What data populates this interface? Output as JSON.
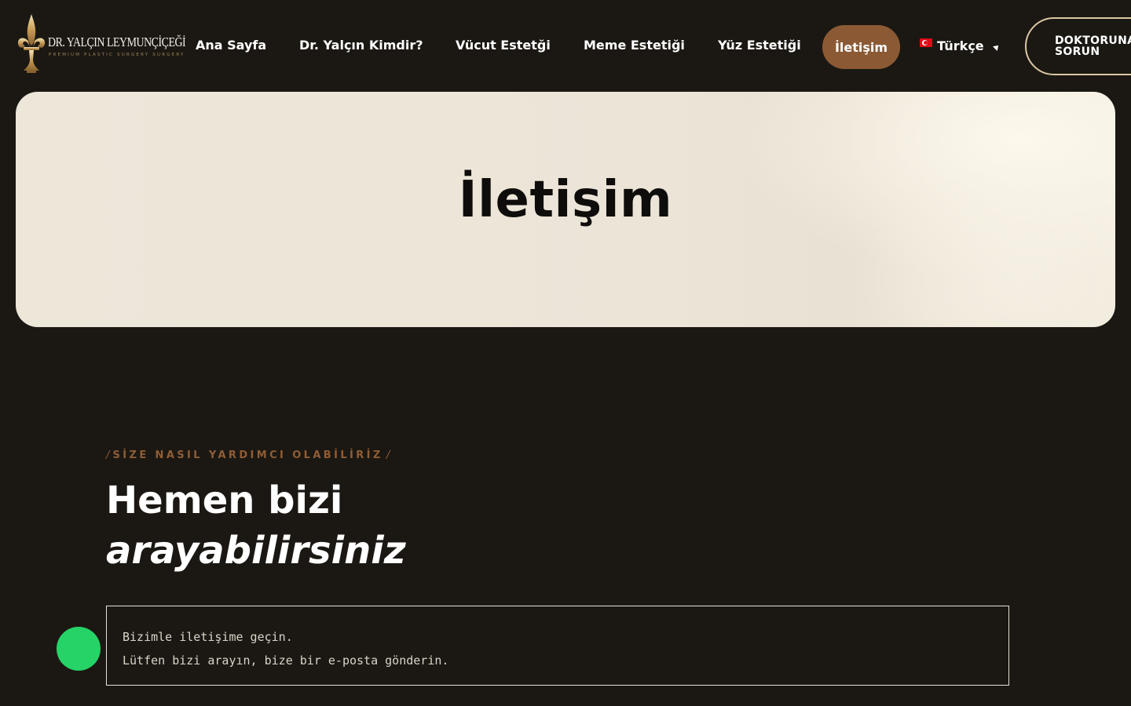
{
  "logo": {
    "name": "DR. YALÇIN LEYMUNÇİÇEĞİ",
    "tagline": "PREMIUM PLASTIC SURGERY SURGERY",
    "icon": "fleur-de-lis-icon"
  },
  "nav": {
    "items": [
      {
        "label": "Ana Sayfa"
      },
      {
        "label": "Dr. Yalçın Kimdir?"
      },
      {
        "label": "Vücut Estetği"
      },
      {
        "label": "Meme Estetiği"
      },
      {
        "label": "Yüz Estetiği"
      }
    ],
    "active": "İletişim",
    "language": "Türkçe",
    "cta_line1": "DOKTORUNA",
    "cta_line2": "SORUN"
  },
  "hero": {
    "title": "İletişim"
  },
  "section": {
    "kicker": "SİZE NASIL YARDIMCI OLABİLİRİZ",
    "heading_line1": "Hemen bizi",
    "heading_line2": "arayabilirsiniz",
    "box_line1": "Bizimle iletişime geçin.",
    "box_line2": "Lütfen bizi arayın, bize bir e-posta gönderin."
  },
  "float_button": {
    "icon": "whatsapp-icon",
    "glyph": ""
  },
  "colors": {
    "background": "#1b1813",
    "accent": "#8b5a34",
    "kicker": "#8f5d35",
    "whatsapp": "#25d366"
  }
}
